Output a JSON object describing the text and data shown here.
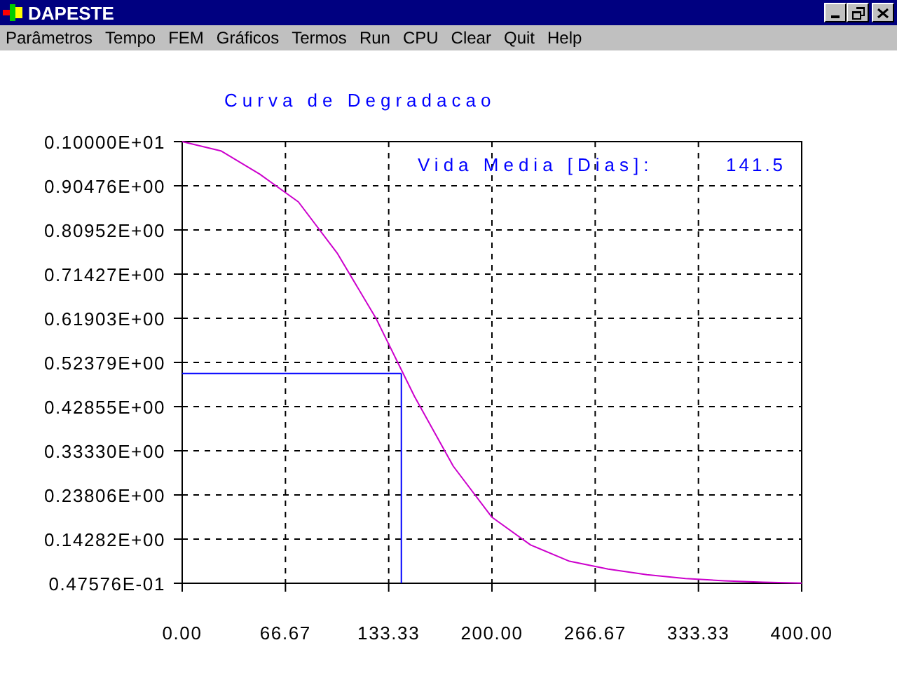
{
  "window": {
    "title": "DAPESTE"
  },
  "menu": [
    {
      "label": "Parâmetros"
    },
    {
      "label": "Tempo"
    },
    {
      "label": "FEM"
    },
    {
      "label": "Gráficos"
    },
    {
      "label": "Termos"
    },
    {
      "label": "Run"
    },
    {
      "label": "CPU"
    },
    {
      "label": "Clear"
    },
    {
      "label": "Quit"
    },
    {
      "label": "Help"
    }
  ],
  "result": {
    "label": "Vida Media [Dias]:",
    "value": "141.5"
  },
  "chart_data": {
    "type": "line",
    "title": "Curva de Degradacao",
    "x": [
      0,
      25,
      50,
      75,
      100,
      125,
      150,
      175,
      200,
      225,
      250,
      275,
      300,
      325,
      350,
      375,
      400
    ],
    "series": [
      {
        "color": "#cc00cc",
        "values": [
          1.0,
          0.98,
          0.93,
          0.87,
          0.76,
          0.62,
          0.45,
          0.3,
          0.19,
          0.13,
          0.095,
          0.078,
          0.066,
          0.058,
          0.053,
          0.05,
          0.048
        ]
      }
    ],
    "xlim": [
      0,
      400
    ],
    "ylim": [
      0.047576,
      1.0
    ],
    "grid": true,
    "ref_lines": [
      {
        "axis": "y",
        "value": 0.5,
        "color": "#0000ff"
      },
      {
        "axis": "x",
        "value": 141.5,
        "color": "#0000ff"
      }
    ],
    "xticks": [
      {
        "value": 0,
        "label": "0.00"
      },
      {
        "value": 66.67,
        "label": "66.67"
      },
      {
        "value": 133.33,
        "label": "133.33"
      },
      {
        "value": 200,
        "label": "200.00"
      },
      {
        "value": 266.67,
        "label": "266.67"
      },
      {
        "value": 333.33,
        "label": "333.33"
      },
      {
        "value": 400,
        "label": "400.00"
      }
    ],
    "yticks": [
      {
        "value": 1.0,
        "label": "0.10000E+01"
      },
      {
        "value": 0.90476,
        "label": "0.90476E+00"
      },
      {
        "value": 0.80952,
        "label": "0.80952E+00"
      },
      {
        "value": 0.71427,
        "label": "0.71427E+00"
      },
      {
        "value": 0.61903,
        "label": "0.61903E+00"
      },
      {
        "value": 0.52379,
        "label": "0.52379E+00"
      },
      {
        "value": 0.42855,
        "label": "0.42855E+00"
      },
      {
        "value": 0.3333,
        "label": "0.33330E+00"
      },
      {
        "value": 0.23806,
        "label": "0.23806E+00"
      },
      {
        "value": 0.14282,
        "label": "0.14282E+00"
      },
      {
        "value": 0.047576,
        "label": "0.47576E-01"
      }
    ]
  }
}
